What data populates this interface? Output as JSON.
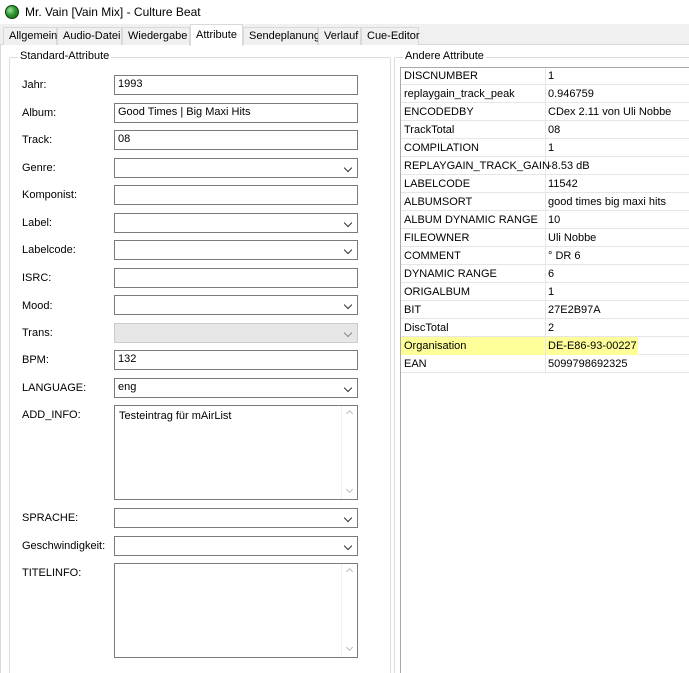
{
  "window": {
    "title": "Mr. Vain [Vain Mix] - Culture Beat"
  },
  "tabs": [
    {
      "label": "Allgemein"
    },
    {
      "label": "Audio-Datei"
    },
    {
      "label": "Wiedergabe"
    },
    {
      "label": "Attribute"
    },
    {
      "label": "Sendeplanung"
    },
    {
      "label": "Verlauf"
    },
    {
      "label": "Cue-Editor"
    }
  ],
  "standard": {
    "title": "Standard-Attribute",
    "jahr": {
      "label": "Jahr:",
      "value": "1993"
    },
    "album": {
      "label": "Album:",
      "value": "Good Times | Big Maxi Hits"
    },
    "track": {
      "label": "Track:",
      "value": "08"
    },
    "genre": {
      "label": "Genre:",
      "value": ""
    },
    "komponist": {
      "label": "Komponist:",
      "value": ""
    },
    "label": {
      "label": "Label:",
      "value": ""
    },
    "labelcode": {
      "label": "Labelcode:",
      "value": ""
    },
    "isrc": {
      "label": "ISRC:",
      "value": ""
    },
    "mood": {
      "label": "Mood:",
      "value": ""
    },
    "trans": {
      "label": "Trans:",
      "value": ""
    },
    "bpm": {
      "label": "BPM:",
      "value": "132"
    },
    "language": {
      "label": "LANGUAGE:",
      "value": "eng"
    },
    "add_info": {
      "label": "ADD_INFO:",
      "value": "Testeintrag für mAirList"
    },
    "sprache": {
      "label": "SPRACHE:",
      "value": ""
    },
    "geschwindigkeit": {
      "label": "Geschwindigkeit:",
      "value": ""
    },
    "titelinfo": {
      "label": "TITELINFO:",
      "value": ""
    }
  },
  "andere": {
    "title": "Andere Attribute",
    "highlight_color": "#ffff99",
    "rows": [
      {
        "key": "DISCNUMBER",
        "value": "1"
      },
      {
        "key": "replaygain_track_peak",
        "value": "0.946759"
      },
      {
        "key": "ENCODEDBY",
        "value": "CDex 2.11 von Uli Nobbe"
      },
      {
        "key": "TrackTotal",
        "value": "08"
      },
      {
        "key": "COMPILATION",
        "value": "1"
      },
      {
        "key": "REPLAYGAIN_TRACK_GAIN",
        "value": "-8.53 dB"
      },
      {
        "key": "LABELCODE",
        "value": "11542"
      },
      {
        "key": "ALBUMSORT",
        "value": "good times big maxi hits"
      },
      {
        "key": "ALBUM DYNAMIC RANGE",
        "value": "10"
      },
      {
        "key": "FILEOWNER",
        "value": "Uli Nobbe"
      },
      {
        "key": "COMMENT",
        "value": "° DR 6"
      },
      {
        "key": "DYNAMIC RANGE",
        "value": "6"
      },
      {
        "key": "ORIGALBUM",
        "value": "1"
      },
      {
        "key": "BIT",
        "value": "27E2B97A"
      },
      {
        "key": "DiscTotal",
        "value": "2"
      },
      {
        "key": "Organisation",
        "value": "DE-E86-93-00227",
        "highlighted": true
      },
      {
        "key": "EAN",
        "value": "5099798692325"
      }
    ]
  }
}
